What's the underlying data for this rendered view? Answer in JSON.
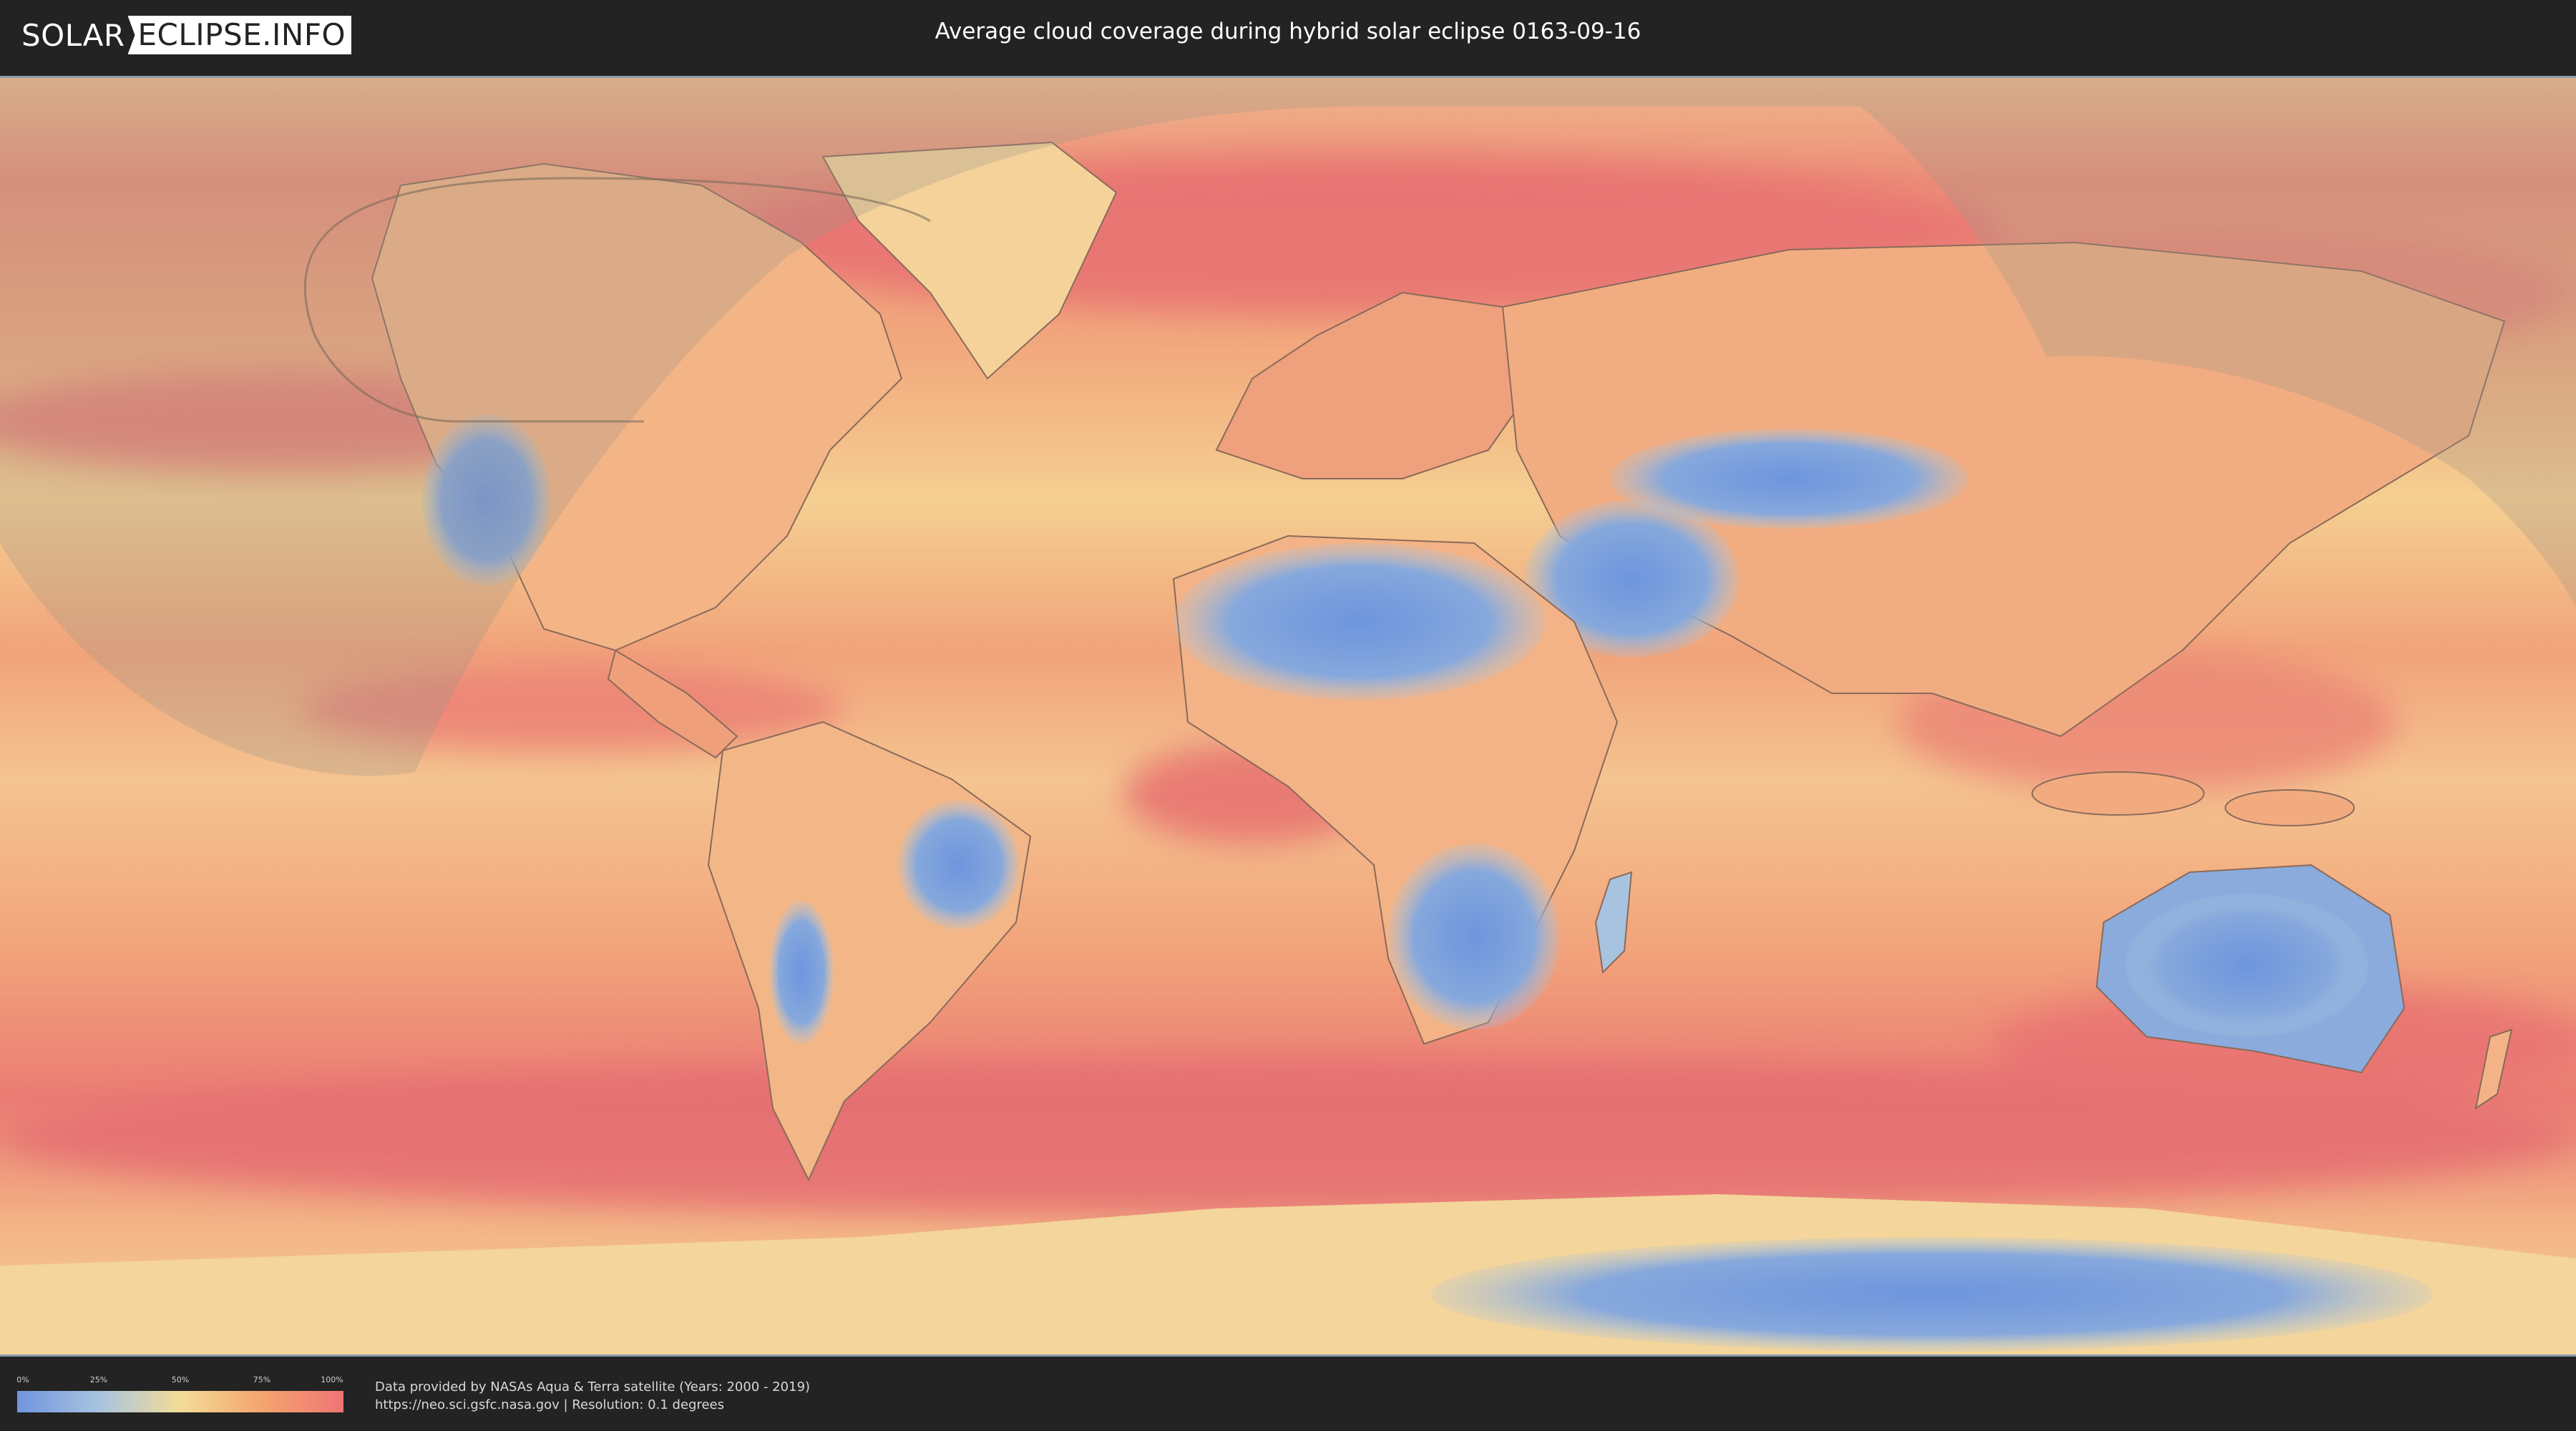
{
  "header": {
    "logo_part1": "SOLAR",
    "logo_part2": "ECLIPSE.INFO",
    "title": "Average cloud coverage during hybrid solar eclipse 0163-09-16"
  },
  "legend": {
    "ticks": [
      "0%",
      "25%",
      "50%",
      "75%",
      "100%"
    ],
    "colors": [
      "#6f95dd",
      "#a8c3df",
      "#f3dc98",
      "#f4a56f",
      "#ef7474"
    ]
  },
  "credits": {
    "line1": "Data provided by NASAs Aqua & Terra satellite (Years: 2000 - 2019)",
    "line2": "https://neo.sci.gsfc.nasa.gov | Resolution: 0.1 degrees"
  },
  "map": {
    "projection": "equirectangular world map",
    "overlay": "eclipse visibility shadow (night side shaded)",
    "colors": {
      "ocean_cloudy": "#ec7d70",
      "mid": "#f4c98a",
      "clear": "#7ea2de",
      "coast": "#8a6a5a"
    }
  }
}
